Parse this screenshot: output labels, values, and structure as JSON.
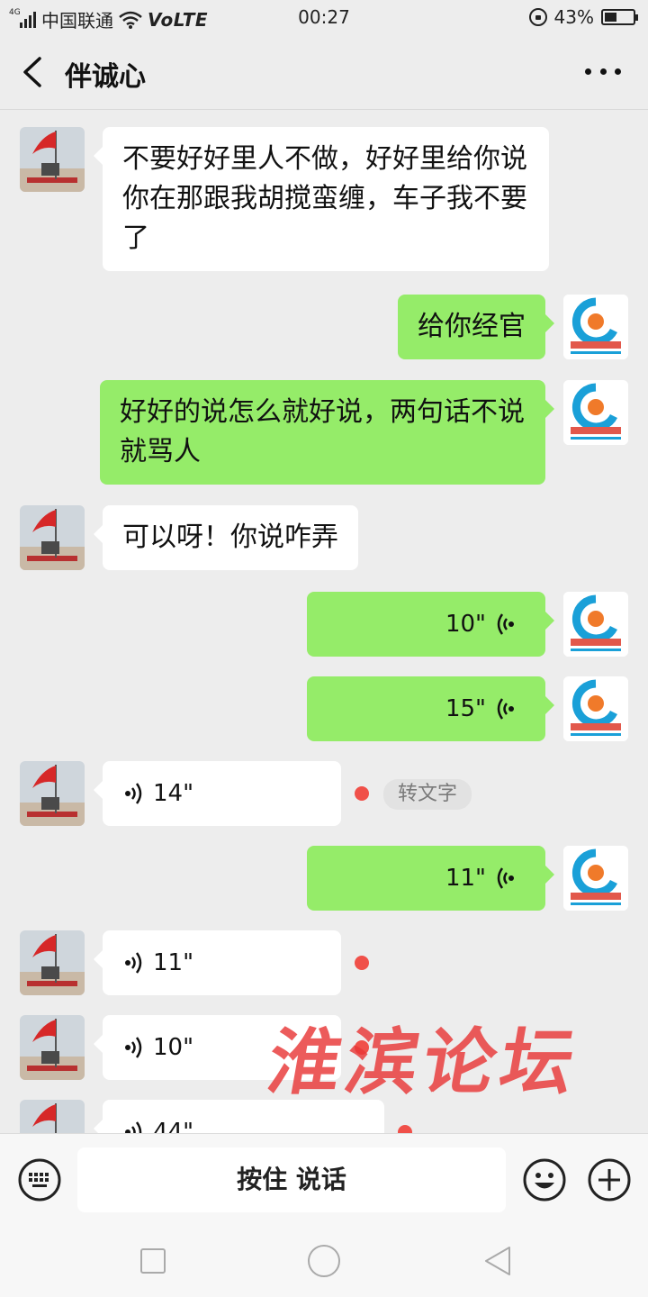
{
  "status_bar": {
    "network_small": "4G",
    "carrier": "中国联通",
    "volte": "VoLTE",
    "time": "00:27",
    "battery": "43%"
  },
  "header": {
    "title": "伴诚心"
  },
  "messages": [
    {
      "from": "friend",
      "type": "text",
      "text": "不要好好里人不做，好好里给你说你在那跟我胡搅蛮缠，车子我不要了"
    },
    {
      "from": "me",
      "type": "text",
      "text": "给你经官"
    },
    {
      "from": "me",
      "type": "text",
      "text": "好好的说怎么就好说，两句话不说就骂人"
    },
    {
      "from": "friend",
      "type": "text",
      "text": "可以呀！你说咋弄"
    },
    {
      "from": "me",
      "type": "voice",
      "duration": "10\""
    },
    {
      "from": "me",
      "type": "voice",
      "duration": "15\""
    },
    {
      "from": "friend",
      "type": "voice",
      "duration": "14\"",
      "unread": true,
      "action": "转文字"
    },
    {
      "from": "me",
      "type": "voice",
      "duration": "11\""
    },
    {
      "from": "friend",
      "type": "voice",
      "duration": "11\"",
      "unread": true
    },
    {
      "from": "friend",
      "type": "voice",
      "duration": "10\"",
      "unread": true
    },
    {
      "from": "friend",
      "type": "voice",
      "duration": "44\"",
      "unread": true
    }
  ],
  "input_bar": {
    "hold_to_talk": "按住 说话"
  },
  "watermark": "淮滨论坛",
  "colors": {
    "background": "#ededed",
    "outgoing_bubble": "#95ec69",
    "incoming_bubble": "#ffffff",
    "unread_dot": "#f05049",
    "watermark": "#e83737"
  }
}
